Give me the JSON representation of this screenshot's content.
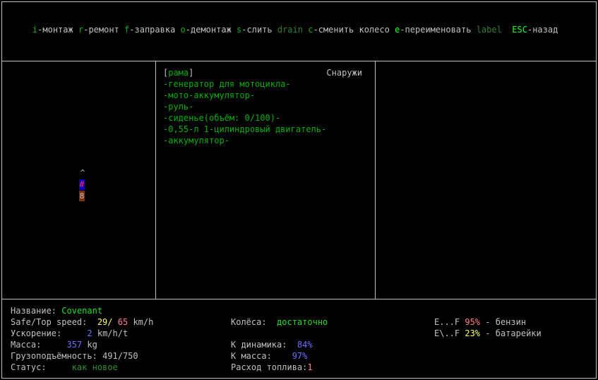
{
  "keybar": {
    "items": [
      {
        "key": "i",
        "sep": "-",
        "label": "монтаж"
      },
      {
        "key": "r",
        "sep": "-",
        "label": "ремонт"
      },
      {
        "key": "f",
        "sep": "-",
        "label": "заправка"
      },
      {
        "key": "o",
        "sep": "-",
        "label": "демонтаж"
      },
      {
        "key": "s",
        "sep": "-",
        "label": "слить"
      },
      {
        "key": "drain",
        "sep": " ",
        "label": ""
      },
      {
        "key": "c",
        "sep": "-",
        "label": "сменить колесо"
      },
      {
        "key": "e",
        "sep": "-",
        "label": "переименовать"
      },
      {
        "key": "label",
        "sep": "",
        "label": ""
      },
      {
        "key": "ESC",
        "sep": "-",
        "label": "назад"
      }
    ]
  },
  "vehicle_map": {
    "tip": "^",
    "seat": "#",
    "body": "8"
  },
  "parts_panel": {
    "bracket_open": "[",
    "frame": "рама",
    "bracket_close": "]",
    "location": "Снаружи",
    "parts": [
      "-генератор для мотоцикла-",
      "-мото-аккумулятор-",
      "-руль-",
      "-сиденье(объём: 0/100)-",
      "-0,55-л 1-цилиндровый двигатель-",
      "-аккумулятор-"
    ]
  },
  "stats": {
    "name_label": "Название:",
    "name_value": "Covenant",
    "speed_label": "Safe/Top speed:",
    "speed_safe": "29/",
    "speed_top": "65",
    "speed_unit": "km/h",
    "accel_label": "Ускорение:",
    "accel_value": "2",
    "accel_unit": "km/h/t",
    "mass_label": "Масса:",
    "mass_value": "357",
    "mass_unit": "kg",
    "capacity_label": "Грузоподъёмность:",
    "capacity_value": "491/750",
    "status_label": "Статус:",
    "status_value": "как новое",
    "wheels_label": "Колёса:",
    "wheels_value": "достаточно",
    "k_dynamics_label": "К динамика:",
    "k_dynamics_value": "84%",
    "k_mass_label": "К масса:",
    "k_mass_value": "97%",
    "fuel_use_label": "Расход топлива:",
    "fuel_use_value": "1",
    "fuel_gauge": "E...F",
    "fuel_pct": "95%",
    "fuel_name": " - бензин",
    "battery_gauge": "E\\..F",
    "battery_pct": "23%",
    "battery_name": " - батарейки"
  }
}
